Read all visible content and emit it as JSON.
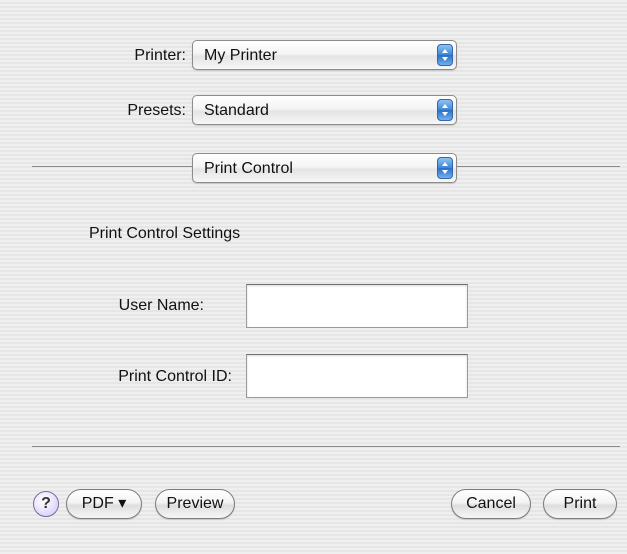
{
  "printer": {
    "label": "Printer:",
    "value": "My Printer"
  },
  "presets": {
    "label": "Presets:",
    "value": "Standard"
  },
  "panel_menu": {
    "value": "Print Control"
  },
  "section": {
    "title": "Print Control Settings"
  },
  "user_name": {
    "label": "User Name:",
    "value": ""
  },
  "print_control_id": {
    "label": "Print Control ID:",
    "value": ""
  },
  "buttons": {
    "help": "?",
    "pdf": "PDF ▾",
    "preview": "Preview",
    "cancel": "Cancel",
    "print": "Print"
  },
  "colors": {
    "accent_popup_arrow": "#3d86d6",
    "help_button": "#cfc2f3",
    "background": "#ececec"
  },
  "icons": {
    "popup_arrows": "up-down-arrows-icon",
    "help": "question-mark-icon"
  }
}
